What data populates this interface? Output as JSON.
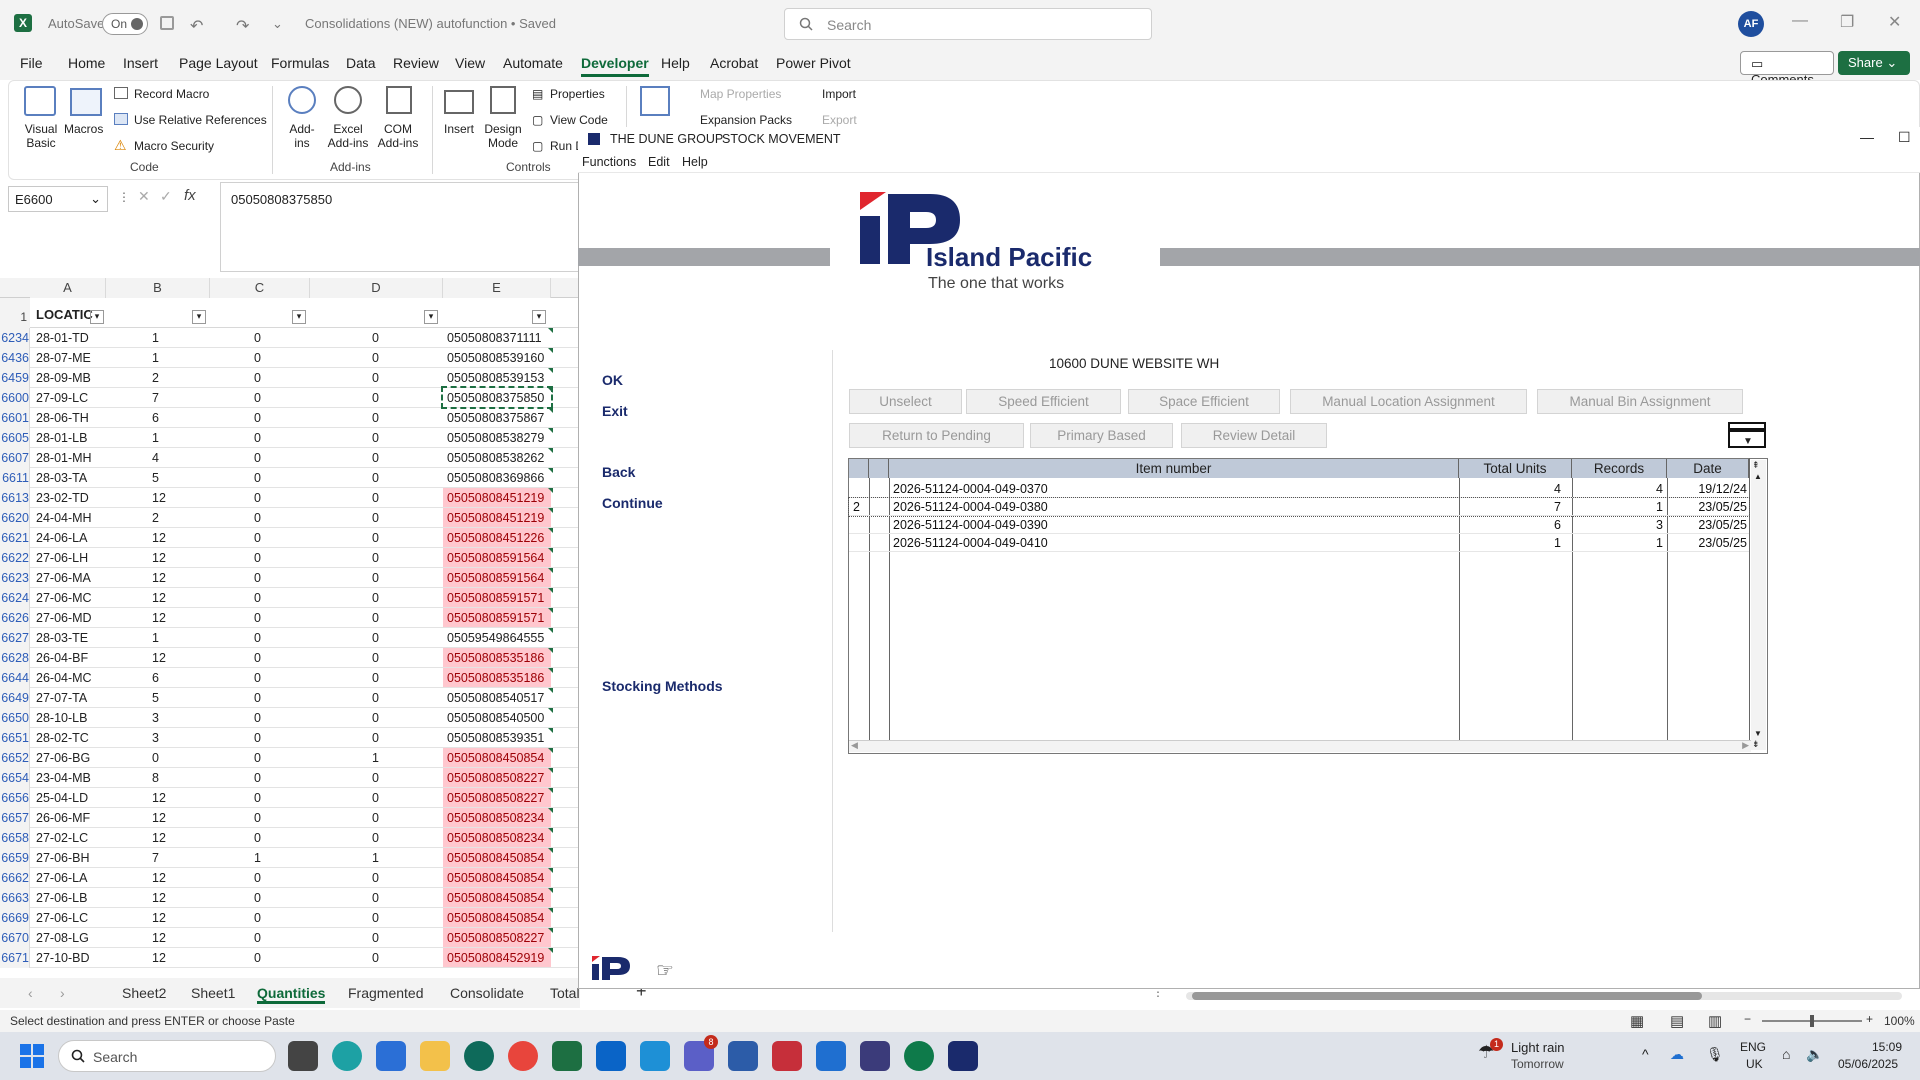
{
  "excel": {
    "autosave_label": "AutoSave",
    "autosave_state": "On",
    "doc_title": "Consolidations (NEW) autofunction • Saved",
    "search_placeholder": "Search",
    "avatar_initials": "AF",
    "menu": [
      "File",
      "Home",
      "Insert",
      "Page Layout",
      "Formulas",
      "Data",
      "Review",
      "View",
      "Automate",
      "Developer",
      "Help",
      "Acrobat",
      "Power Pivot"
    ],
    "active_menu": "Developer",
    "comments_label": "Comments",
    "share_label": "Share",
    "ribbon": {
      "visual_basic": "Visual Basic",
      "macros": "Macros",
      "record_macro": "Record Macro",
      "use_relative": "Use Relative References",
      "macro_security": "Macro Security",
      "code_group": "Code",
      "addins": "Add-ins",
      "excel_addins": "Excel Add-ins",
      "com_addins": "COM Add-ins",
      "addins_group": "Add-ins",
      "insert": "Insert",
      "design_mode": "Design Mode",
      "properties": "Properties",
      "view_code": "View Code",
      "run_dialog": "Run D",
      "controls_group": "Controls",
      "map_properties": "Map Properties",
      "expansion_packs": "Expansion Packs",
      "import": "Import",
      "export": "Export"
    },
    "name_box": "E6600",
    "formula_value": "05050808375850",
    "columns": [
      "A",
      "B",
      "C",
      "D",
      "E"
    ],
    "header_row_num": "1",
    "header_a": "LOCATIC",
    "rows": [
      {
        "n": "6234",
        "a": "28-01-TD",
        "b": "1",
        "c": "0",
        "d": "0",
        "e": "05050808371111",
        "pink": false
      },
      {
        "n": "6436",
        "a": "28-07-ME",
        "b": "1",
        "c": "0",
        "d": "0",
        "e": "05050808539160",
        "pink": false
      },
      {
        "n": "6459",
        "a": "28-09-MB",
        "b": "2",
        "c": "0",
        "d": "0",
        "e": "05050808539153",
        "pink": false
      },
      {
        "n": "6600",
        "a": "27-09-LC",
        "b": "7",
        "c": "0",
        "d": "0",
        "e": "05050808375850",
        "pink": false
      },
      {
        "n": "6601",
        "a": "28-06-TH",
        "b": "6",
        "c": "0",
        "d": "0",
        "e": "05050808375867",
        "pink": false
      },
      {
        "n": "6605",
        "a": "28-01-LB",
        "b": "1",
        "c": "0",
        "d": "0",
        "e": "05050808538279",
        "pink": false
      },
      {
        "n": "6607",
        "a": "28-01-MH",
        "b": "4",
        "c": "0",
        "d": "0",
        "e": "05050808538262",
        "pink": false
      },
      {
        "n": "6611",
        "a": "28-03-TA",
        "b": "5",
        "c": "0",
        "d": "0",
        "e": "05050808369866",
        "pink": false
      },
      {
        "n": "6613",
        "a": "23-02-TD",
        "b": "12",
        "c": "0",
        "d": "0",
        "e": "05050808451219",
        "pink": true
      },
      {
        "n": "6620",
        "a": "24-04-MH",
        "b": "2",
        "c": "0",
        "d": "0",
        "e": "05050808451219",
        "pink": true
      },
      {
        "n": "6621",
        "a": "24-06-LA",
        "b": "12",
        "c": "0",
        "d": "0",
        "e": "05050808451226",
        "pink": true
      },
      {
        "n": "6622",
        "a": "27-06-LH",
        "b": "12",
        "c": "0",
        "d": "0",
        "e": "05050808591564",
        "pink": true
      },
      {
        "n": "6623",
        "a": "27-06-MA",
        "b": "12",
        "c": "0",
        "d": "0",
        "e": "05050808591564",
        "pink": true
      },
      {
        "n": "6624",
        "a": "27-06-MC",
        "b": "12",
        "c": "0",
        "d": "0",
        "e": "05050808591571",
        "pink": true
      },
      {
        "n": "6626",
        "a": "27-06-MD",
        "b": "12",
        "c": "0",
        "d": "0",
        "e": "05050808591571",
        "pink": true
      },
      {
        "n": "6627",
        "a": "28-03-TE",
        "b": "1",
        "c": "0",
        "d": "0",
        "e": "05059549864555",
        "pink": false
      },
      {
        "n": "6628",
        "a": "26-04-BF",
        "b": "12",
        "c": "0",
        "d": "0",
        "e": "05050808535186",
        "pink": true
      },
      {
        "n": "6644",
        "a": "26-04-MC",
        "b": "6",
        "c": "0",
        "d": "0",
        "e": "05050808535186",
        "pink": true
      },
      {
        "n": "6649",
        "a": "27-07-TA",
        "b": "5",
        "c": "0",
        "d": "0",
        "e": "05050808540517",
        "pink": false
      },
      {
        "n": "6650",
        "a": "28-10-LB",
        "b": "3",
        "c": "0",
        "d": "0",
        "e": "05050808540500",
        "pink": false
      },
      {
        "n": "6651",
        "a": "28-02-TC",
        "b": "3",
        "c": "0",
        "d": "0",
        "e": "05050808539351",
        "pink": false
      },
      {
        "n": "6652",
        "a": "27-06-BG",
        "b": "0",
        "c": "0",
        "d": "1",
        "e": "05050808450854",
        "pink": true
      },
      {
        "n": "6654",
        "a": "23-04-MB",
        "b": "8",
        "c": "0",
        "d": "0",
        "e": "05050808508227",
        "pink": true
      },
      {
        "n": "6656",
        "a": "25-04-LD",
        "b": "12",
        "c": "0",
        "d": "0",
        "e": "05050808508227",
        "pink": true
      },
      {
        "n": "6657",
        "a": "26-06-MF",
        "b": "12",
        "c": "0",
        "d": "0",
        "e": "05050808508234",
        "pink": true
      },
      {
        "n": "6658",
        "a": "27-02-LC",
        "b": "12",
        "c": "0",
        "d": "0",
        "e": "05050808508234",
        "pink": true
      },
      {
        "n": "6659",
        "a": "27-06-BH",
        "b": "7",
        "c": "1",
        "d": "1",
        "e": "05050808450854",
        "pink": true
      },
      {
        "n": "6662",
        "a": "27-06-LA",
        "b": "12",
        "c": "0",
        "d": "0",
        "e": "05050808450854",
        "pink": true
      },
      {
        "n": "6663",
        "a": "27-06-LB",
        "b": "12",
        "c": "0",
        "d": "0",
        "e": "05050808450854",
        "pink": true
      },
      {
        "n": "6669",
        "a": "27-06-LC",
        "b": "12",
        "c": "0",
        "d": "0",
        "e": "05050808450854",
        "pink": true
      },
      {
        "n": "6670",
        "a": "27-08-LG",
        "b": "12",
        "c": "0",
        "d": "0",
        "e": "05050808508227",
        "pink": true
      },
      {
        "n": "6671",
        "a": "27-10-BD",
        "b": "12",
        "c": "0",
        "d": "0",
        "e": "05050808452919",
        "pink": true
      }
    ],
    "sheet_tabs": [
      "Sheet2",
      "Sheet1",
      "Quantities",
      "Fragmented",
      "Consolidate",
      "Total"
    ],
    "active_tab": "Quantities",
    "status_text": "Select destination and press ENTER or choose Paste",
    "zoom": "100%"
  },
  "ip": {
    "window_title": "THE DUNE GROUP",
    "window_subtitle": "STOCK MOVEMENT",
    "menu": [
      "Functions",
      "Edit",
      "Help"
    ],
    "logo_text": "Island Pacific",
    "logo_tagline": "The one that works",
    "warehouse": "10600 DUNE WEBSITE WH",
    "left_links": {
      "ok": "OK",
      "exit": "Exit",
      "back": "Back",
      "continue": "Continue",
      "stocking": "Stocking Methods"
    },
    "buttons_row1": [
      "Unselect",
      "Speed Efficient",
      "Space Efficient",
      "Manual Location Assignment",
      "Manual Bin Assignment"
    ],
    "buttons_row2": [
      "Return to Pending",
      "Primary Based",
      "Review Detail"
    ],
    "table_headers": [
      "Item number",
      "Total Units",
      "Records",
      "Date"
    ],
    "table_rows": [
      {
        "sel": "",
        "item": "2026-51124-0004-049-0370",
        "units": "4",
        "records": "4",
        "date": "19/12/24"
      },
      {
        "sel": "2",
        "item": "2026-51124-0004-049-0380",
        "units": "7",
        "records": "1",
        "date": "23/05/25"
      },
      {
        "sel": "",
        "item": "2026-51124-0004-049-0390",
        "units": "6",
        "records": "3",
        "date": "23/05/25"
      },
      {
        "sel": "",
        "item": "2026-51124-0004-049-0410",
        "units": "1",
        "records": "1",
        "date": "23/05/25"
      }
    ]
  },
  "taskbar": {
    "search": "Search",
    "weather_main": "Light rain",
    "weather_sub": "Tomorrow",
    "weather_badge": "1",
    "teams_badge": "8",
    "lang": "ENG",
    "region": "UK",
    "time": "15:09",
    "date": "05/06/2025"
  },
  "colors": {
    "excel_green": "#0e6a3a",
    "ip_navy": "#1a2a6c",
    "ip_red": "#e0262e",
    "pink": "#ffc7ce"
  }
}
